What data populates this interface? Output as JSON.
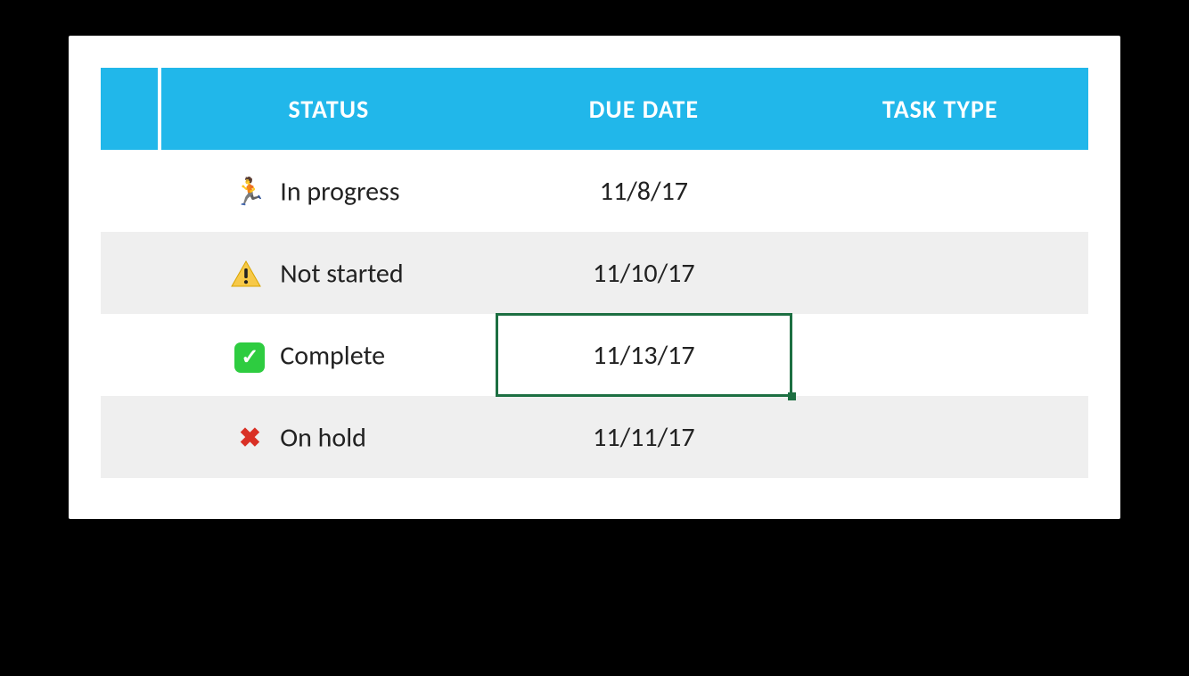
{
  "table": {
    "headers": {
      "empty": "",
      "status": "STATUS",
      "due_date": "DUE DATE",
      "task_type": "TASK TYPE"
    },
    "rows": [
      {
        "icon": "runner-icon",
        "status_label": "In progress",
        "due_date": "11/8/17",
        "task_type": ""
      },
      {
        "icon": "warning-icon",
        "status_label": "Not started",
        "due_date": "11/10/17",
        "task_type": ""
      },
      {
        "icon": "checkmark-icon",
        "status_label": "Complete",
        "due_date": "11/13/17",
        "task_type": ""
      },
      {
        "icon": "cross-icon",
        "status_label": "On hold",
        "due_date": "11/11/17",
        "task_type": ""
      }
    ],
    "selected_cell": {
      "row": 2,
      "col": "due_date"
    }
  }
}
